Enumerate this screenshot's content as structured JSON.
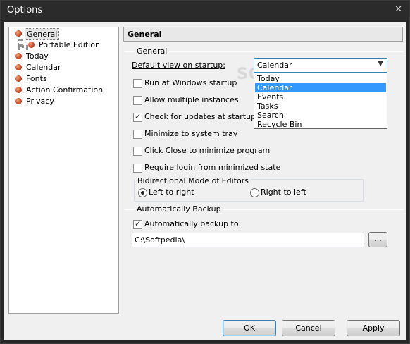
{
  "window": {
    "title": "Options",
    "close_glyph": "✕"
  },
  "tree": {
    "items": [
      {
        "label": "General",
        "selected": true
      },
      {
        "label": "Portable Edition",
        "child": true
      },
      {
        "label": "Today"
      },
      {
        "label": "Calendar"
      },
      {
        "label": "Fonts"
      },
      {
        "label": "Action Confirmation"
      },
      {
        "label": "Privacy"
      }
    ]
  },
  "panel": {
    "title": "General",
    "general_section": "General",
    "default_view_label": "Default view on startup:",
    "combo": {
      "value": "Calendar",
      "arrow_icon": "chevron-down-icon"
    },
    "dropdown_options": [
      "Today",
      "Calendar",
      "Events",
      "Tasks",
      "Search",
      "Recycle Bin"
    ],
    "dropdown_highlighted": "Calendar",
    "watermark": "SOFTPEDIA",
    "checkboxes": [
      {
        "label": "Run at Windows startup",
        "checked": false
      },
      {
        "label": "Allow multiple instances",
        "checked": false
      },
      {
        "label": "Check for updates at startup",
        "checked": true
      },
      {
        "label": "Minimize to system tray",
        "checked": false
      },
      {
        "label": "Click Close to minimize program",
        "checked": false
      },
      {
        "label": "Require login from minimized state",
        "checked": false
      }
    ],
    "bidi": {
      "title": "Bidirectional Mode of Editors",
      "left_to_right": "Left to right",
      "right_to_left": "Right to left",
      "selected": "Left to right"
    },
    "backup_section": "Automatically Backup",
    "backup_checkbox": {
      "label": "Automatically backup to:",
      "checked": true
    },
    "backup_path": "C:\\Softpedia\\",
    "browse_label": "..."
  },
  "buttons": {
    "ok": "OK",
    "cancel": "Cancel",
    "apply": "Apply"
  }
}
